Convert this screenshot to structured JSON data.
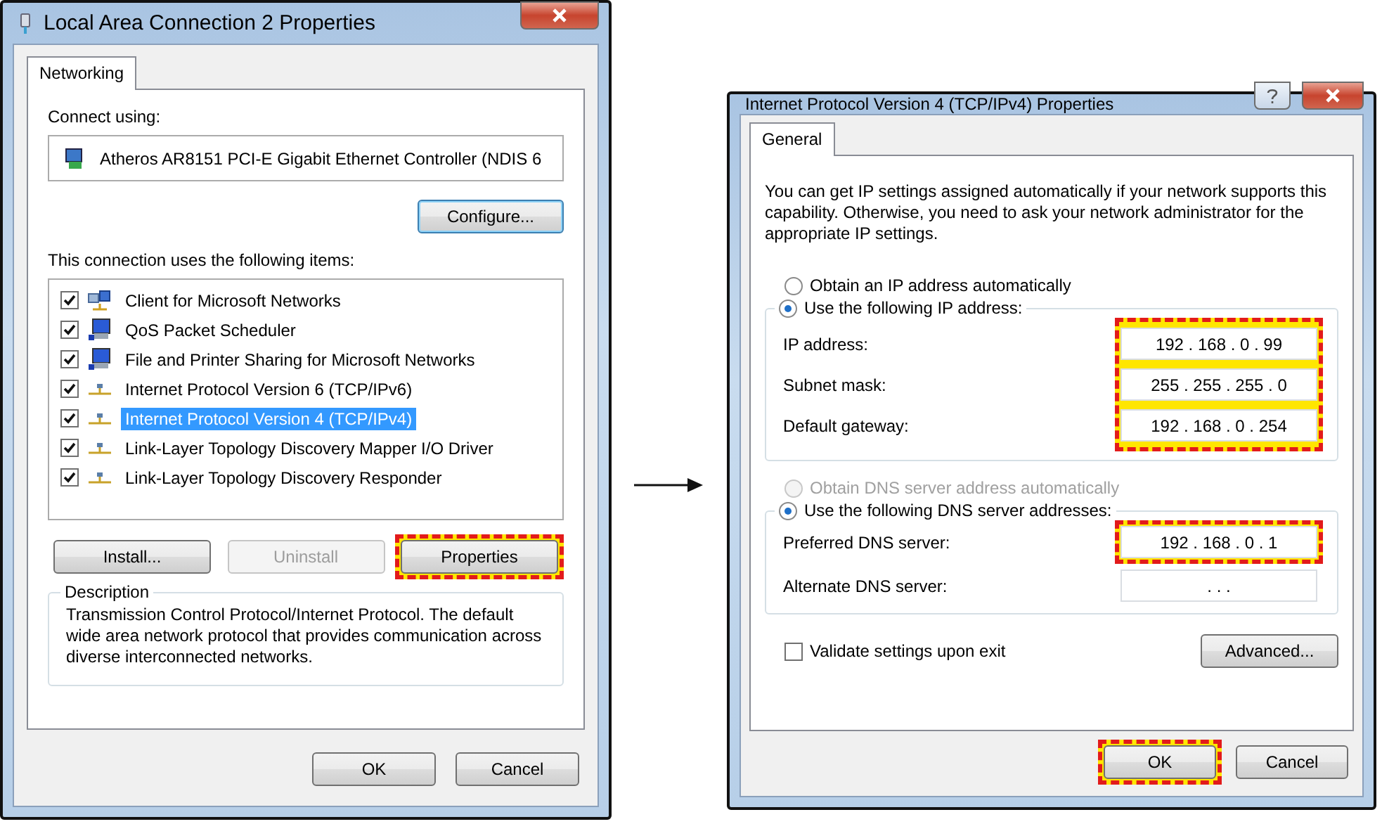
{
  "left_window": {
    "title": "Local Area Connection 2 Properties",
    "tabs": [
      {
        "label": "Networking",
        "selected": true
      }
    ],
    "connect_using_label": "Connect using:",
    "adapter": "Atheros AR8151 PCI-E Gigabit Ethernet Controller (NDIS 6",
    "configure_button": "Configure...",
    "items_label": "This connection uses the following items:",
    "items": [
      {
        "label": "Client for Microsoft Networks",
        "checked": true,
        "selected": false,
        "kind": "client"
      },
      {
        "label": "QoS Packet Scheduler",
        "checked": true,
        "selected": false,
        "kind": "service"
      },
      {
        "label": "File and Printer Sharing for Microsoft Networks",
        "checked": true,
        "selected": false,
        "kind": "service"
      },
      {
        "label": "Internet Protocol Version 6 (TCP/IPv6)",
        "checked": true,
        "selected": false,
        "kind": "protocol"
      },
      {
        "label": "Internet Protocol Version 4 (TCP/IPv4)",
        "checked": true,
        "selected": true,
        "kind": "protocol"
      },
      {
        "label": "Link-Layer Topology Discovery Mapper I/O Driver",
        "checked": true,
        "selected": false,
        "kind": "protocol"
      },
      {
        "label": "Link-Layer Topology Discovery Responder",
        "checked": true,
        "selected": false,
        "kind": "protocol"
      }
    ],
    "buttons": [
      {
        "label": "Install...",
        "disabled": false,
        "highlighted": false
      },
      {
        "label": "Uninstall",
        "disabled": true,
        "highlighted": false
      },
      {
        "label": "Properties",
        "disabled": false,
        "highlighted": true
      }
    ],
    "description": {
      "legend": "Description",
      "text": "Transmission Control Protocol/Internet Protocol. The default wide area network protocol that provides communication across diverse interconnected networks."
    },
    "footer_buttons": [
      {
        "label": "OK",
        "highlighted": false
      },
      {
        "label": "Cancel",
        "highlighted": false
      }
    ]
  },
  "right_window": {
    "title": "Internet Protocol Version 4 (TCP/IPv4) Properties",
    "tabs": [
      {
        "label": "General",
        "selected": true
      }
    ],
    "intro": "You can get IP settings assigned automatically if your network supports this capability. Otherwise, you need to ask your network administrator for the appropriate IP settings.",
    "ip_options": [
      {
        "label": "Obtain an IP address automatically",
        "selected": false,
        "disabled": false
      },
      {
        "label": "Use the following IP address:",
        "selected": true,
        "disabled": false
      }
    ],
    "ip_fields_highlighted": true,
    "ip_fields": [
      {
        "label": "IP address:",
        "value": "192 . 168 . 0 . 99"
      },
      {
        "label": "Subnet mask:",
        "value": "255 . 255 . 255 . 0"
      },
      {
        "label": "Default gateway:",
        "value": "192 . 168 . 0 . 254"
      }
    ],
    "dns_options": [
      {
        "label": "Obtain DNS server address automatically",
        "selected": false,
        "disabled": true
      },
      {
        "label": "Use the following DNS server addresses:",
        "selected": true,
        "disabled": false
      }
    ],
    "dns_fields": [
      {
        "label": "Preferred DNS server:",
        "value": "192 . 168 . 0 . 1",
        "highlighted": true
      },
      {
        "label": "Alternate DNS server:",
        "value": ". . .",
        "highlighted": false
      }
    ],
    "validate": {
      "label": "Validate settings upon exit",
      "checked": false
    },
    "advanced_button": "Advanced...",
    "footer_buttons": [
      {
        "label": "OK",
        "highlighted": true
      },
      {
        "label": "Cancel",
        "highlighted": false
      }
    ]
  }
}
